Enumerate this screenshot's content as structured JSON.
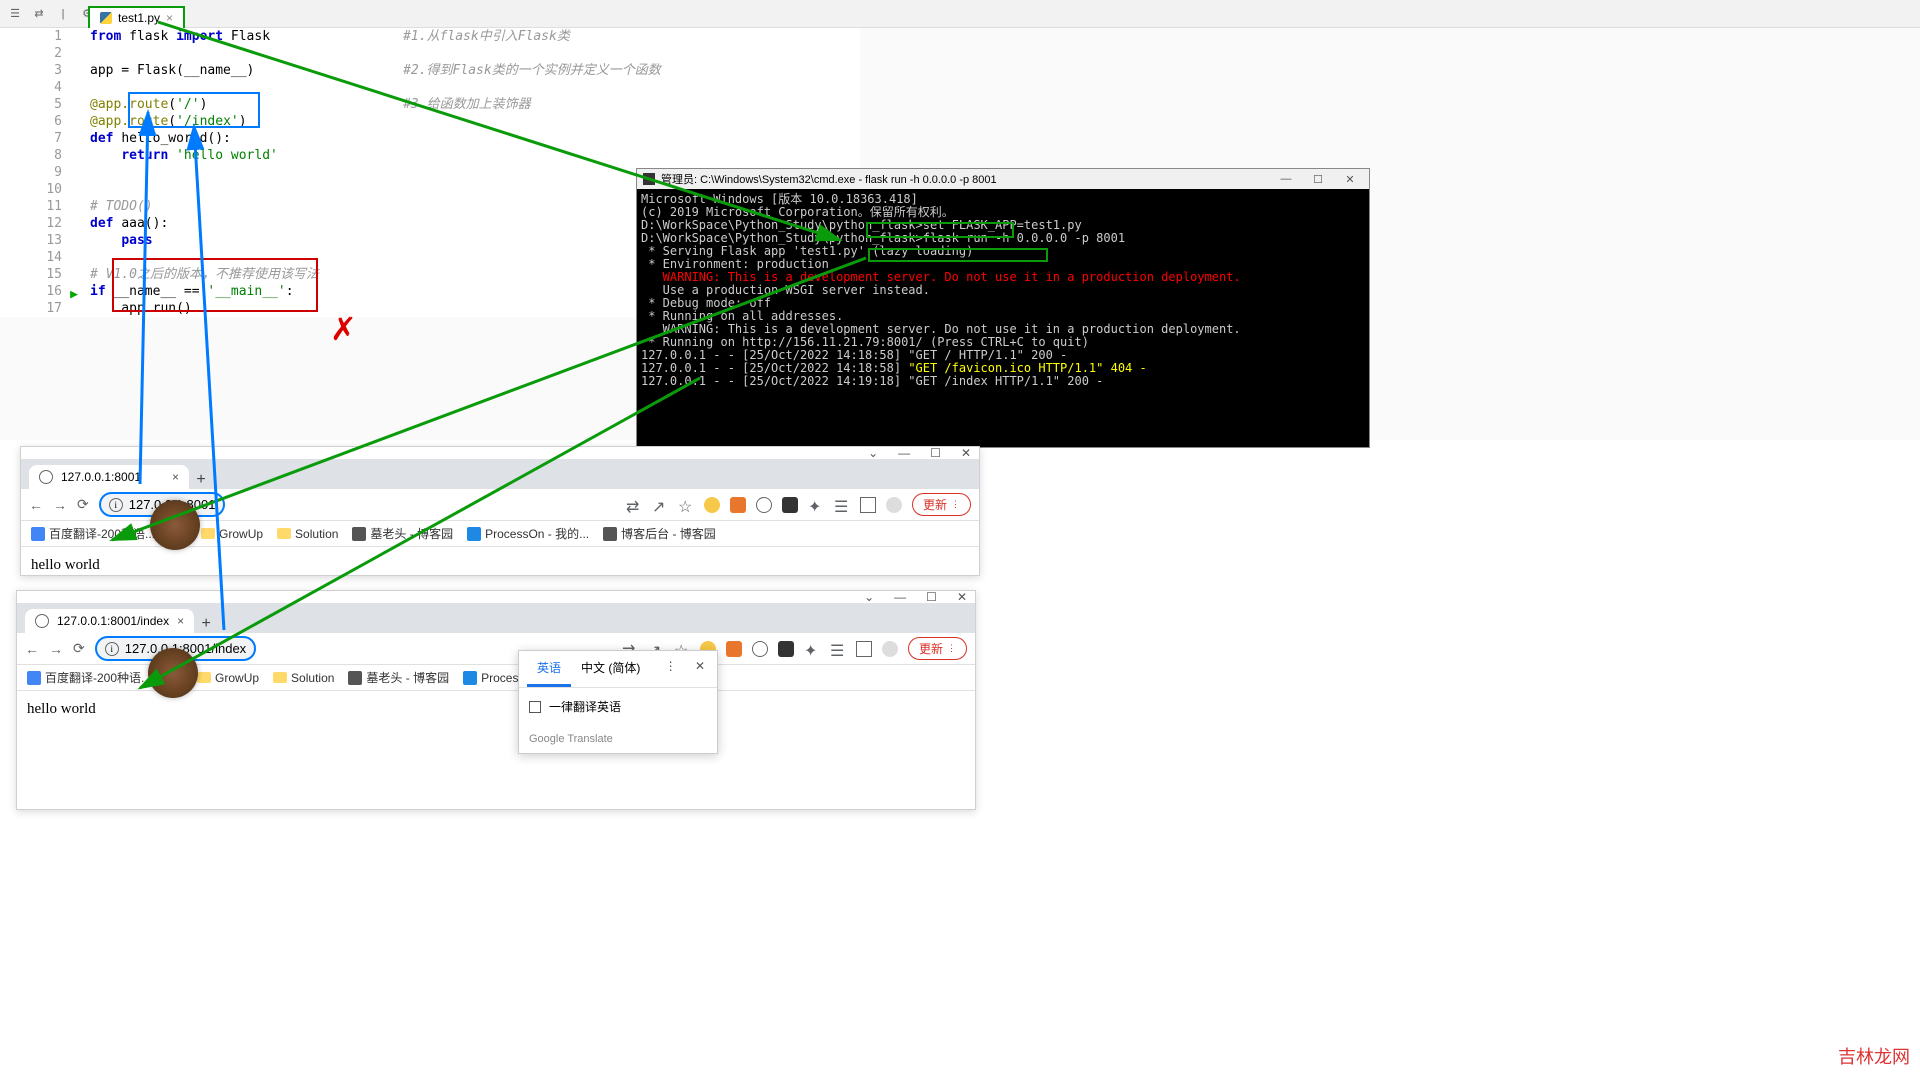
{
  "ide": {
    "tab_name": "test1.py",
    "code": [
      {
        "n": 1,
        "html": "<span class='kw'>from</span> flask <span class='kw'>import</span> Flask",
        "cmt": "#1.从flask中引入Flask类"
      },
      {
        "n": 2,
        "html": "",
        "cmt": ""
      },
      {
        "n": 3,
        "html": "app = Flask(__name__)",
        "cmt": "#2.得到Flask类的一个实例并定义一个函数"
      },
      {
        "n": 4,
        "html": "",
        "cmt": ""
      },
      {
        "n": 5,
        "html": "<span class='dec'>@app.route</span>(<span class='str'>'/'</span>)",
        "cmt": "#3.给函数加上装饰器"
      },
      {
        "n": 6,
        "html": "<span class='dec'>@app.route</span>(<span class='str'>'<u>/index</u>'</span>)",
        "cmt": ""
      },
      {
        "n": 7,
        "html": "<span class='kw'>def</span> <span class='fn'>hello_world</span>():",
        "cmt": ""
      },
      {
        "n": 8,
        "html": "    <span class='kw'>return</span> <span class='str'>'hello world'</span>",
        "cmt": ""
      },
      {
        "n": 9,
        "html": "",
        "cmt": ""
      },
      {
        "n": 10,
        "html": "",
        "cmt": ""
      },
      {
        "n": 11,
        "html": "<span class='cmt'># TODO()</span>",
        "cmt": ""
      },
      {
        "n": 12,
        "html": "<span class='kw'>def</span> <span class='fn'>aaa</span>():",
        "cmt": ""
      },
      {
        "n": 13,
        "html": "    <span class='kw'>pass</span>",
        "cmt": ""
      },
      {
        "n": 14,
        "html": "",
        "cmt": ""
      },
      {
        "n": 15,
        "html": "<span class='cmt'># V1.0之后的版本，不推荐使用该写法</span>",
        "cmt": ""
      },
      {
        "n": 16,
        "html": "<span class='kw'>if</span> __name__ == <span class='str'>'__main__'</span>:",
        "cmt": "",
        "bp": true
      },
      {
        "n": 17,
        "html": "    app.run()",
        "cmt": ""
      }
    ]
  },
  "terminal": {
    "title": "管理员: C:\\Windows\\System32\\cmd.exe - flask  run -h 0.0.0.0 -p 8001",
    "lines": [
      {
        "t": "Microsoft Windows [版本 10.0.18363.418]"
      },
      {
        "t": "(c) 2019 Microsoft Corporation。保留所有权利。"
      },
      {
        "t": ""
      },
      {
        "t": "D:\\WorkSpace\\Python_Study\\python_flask>set FLASK_APP=test1.py"
      },
      {
        "t": ""
      },
      {
        "t": "D:\\WorkSpace\\Python_Study\\python_flask>flask run -h 0.0.0.0 -p 8001"
      },
      {
        "t": " * Serving Flask app 'test1.py' (lazy loading)"
      },
      {
        "t": " * Environment: production"
      },
      {
        "t": "   WARNING: This is a development server. Do not use it in a production deployment.",
        "cls": "r"
      },
      {
        "t": "   Use a production WSGI server instead."
      },
      {
        "t": " * Debug mode: off"
      },
      {
        "t": " * Running on all addresses."
      },
      {
        "t": "   WARNING: This is a development server. Do not use it in a production deployment."
      },
      {
        "t": " * Running on http://156.11.21.79:8001/ (Press CTRL+C to quit)"
      },
      {
        "t": "127.0.0.1 - - [25/Oct/2022 14:18:58] \"GET / HTTP/1.1\" 200 -"
      },
      {
        "t": "127.0.0.1 - - [25/Oct/2022 14:18:58] \"GET /favicon.ico HTTP/1.1\" 404 -",
        "mix": true,
        "yellow": "\"GET /favicon.ico HTTP/1.1\" 404 -"
      },
      {
        "t": "127.0.0.1 - - [25/Oct/2022 14:19:18] \"GET /index HTTP/1.1\" 200 -"
      }
    ],
    "box1": "set FLASK_APP=test1.py",
    "box2": "flask run -h 0.0.0.0 -p 8001"
  },
  "browsers": [
    {
      "tab_title": "127.0.0.1:8001",
      "url": "127.0.0.1:8001",
      "content": "hello world",
      "update": "更新"
    },
    {
      "tab_title": "127.0.0.1:8001/index",
      "url": "127.0.0.1:8001/index",
      "content": "hello world",
      "update": "更新"
    }
  ],
  "bookmarks": [
    {
      "label": "百度翻译-200种语...",
      "color": "#4285f4"
    },
    {
      "label": "",
      "folder": true
    },
    {
      "label": "GrowUp",
      "folder": true
    },
    {
      "label": "Solution",
      "folder": true
    },
    {
      "label": "墓老头 - 博客园",
      "color": "#555"
    },
    {
      "label": "ProcessOn - 我的...",
      "color": "#1e88e5"
    },
    {
      "label": "博客后台 - 博客园",
      "color": "#555"
    }
  ],
  "translate": {
    "tab1": "英语",
    "tab2": "中文 (简体)",
    "always": "一律翻译英语",
    "footer": "Google Translate"
  },
  "watermark": "吉林龙网"
}
